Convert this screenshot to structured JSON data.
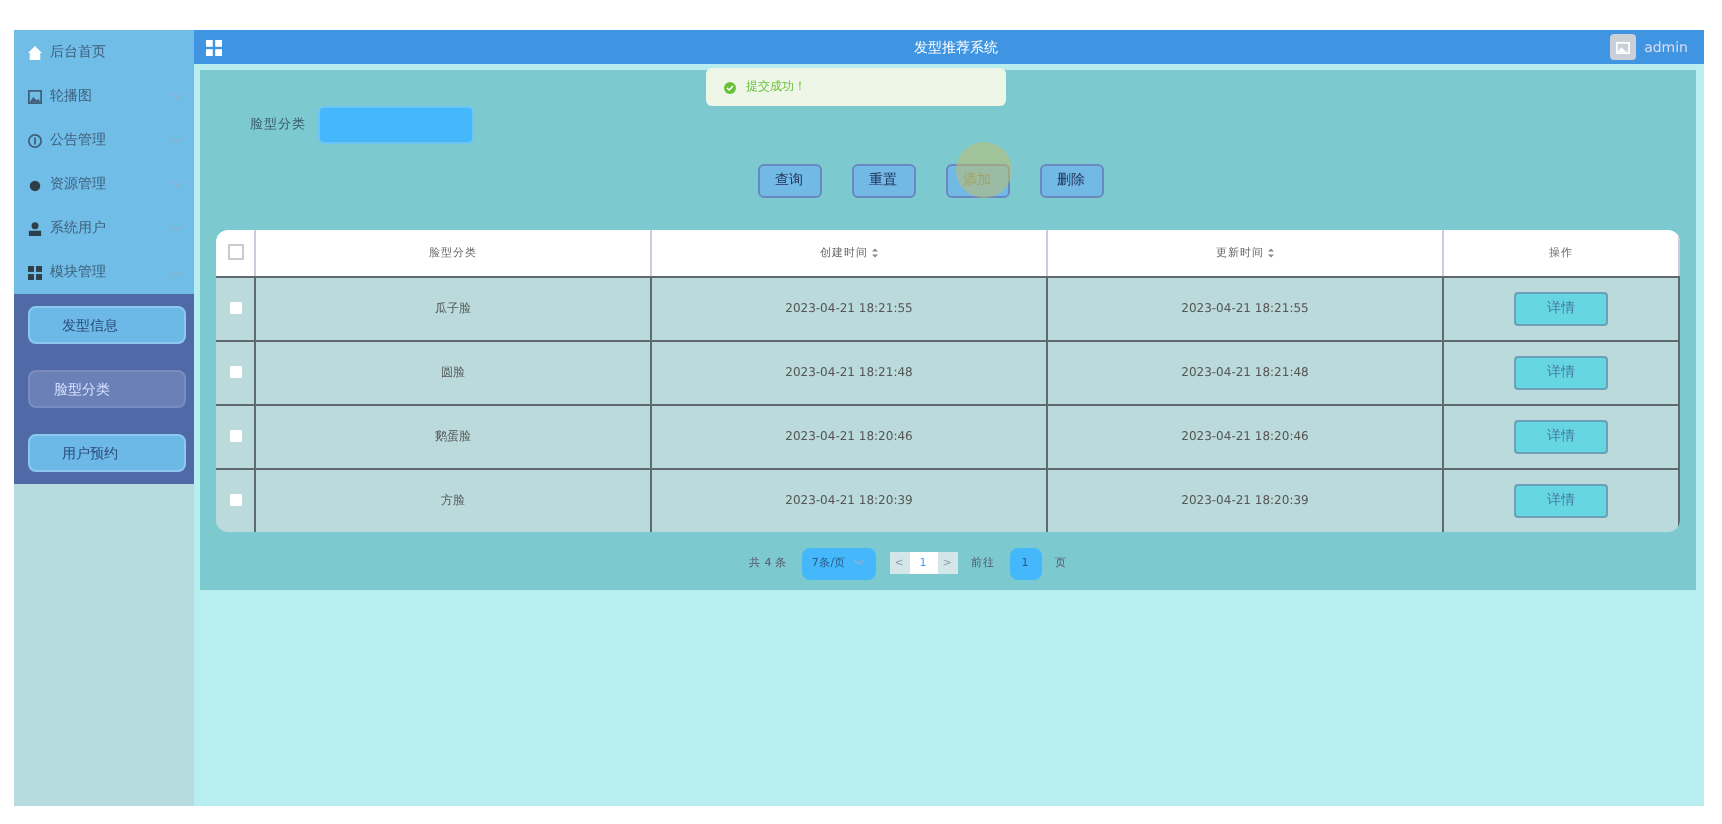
{
  "header": {
    "title": "发型推荐系统",
    "user": "admin"
  },
  "toast": {
    "text": "提交成功！"
  },
  "sidebar": {
    "items": [
      {
        "label": "后台首页",
        "kind": "link"
      },
      {
        "label": "轮播图",
        "kind": "menu",
        "expanded": false
      },
      {
        "label": "公告管理",
        "kind": "menu",
        "expanded": false
      },
      {
        "label": "资源管理",
        "kind": "menu",
        "expanded": false
      },
      {
        "label": "系统用户",
        "kind": "menu",
        "expanded": false
      },
      {
        "label": "模块管理",
        "kind": "menu",
        "expanded": true,
        "children": [
          {
            "label": "发型信息",
            "selected": false
          },
          {
            "label": "脸型分类",
            "selected": true
          },
          {
            "label": "用户预约",
            "selected": false
          }
        ]
      }
    ]
  },
  "search": {
    "label": "脸型分类"
  },
  "buttons": [
    {
      "label": "查询",
      "hovered": false
    },
    {
      "label": "重置",
      "hovered": false
    },
    {
      "label": "添加",
      "hovered": true
    },
    {
      "label": "删除",
      "hovered": false
    }
  ],
  "table": {
    "all_checked": false,
    "columns": [
      {
        "label": "脸型分类",
        "sortable": false
      },
      {
        "label": "创建时间",
        "sortable": true
      },
      {
        "label": "更新时间",
        "sortable": true
      },
      {
        "label": "操作",
        "sortable": false
      }
    ],
    "rows": [
      {
        "checked": false,
        "cells": [
          "瓜子脸",
          "2023-04-21 18:21:55",
          "2023-04-21 18:21:55"
        ],
        "action": "详情"
      },
      {
        "checked": false,
        "cells": [
          "圆脸",
          "2023-04-21 18:21:48",
          "2023-04-21 18:21:48"
        ],
        "action": "详情"
      },
      {
        "checked": false,
        "cells": [
          "鹅蛋脸",
          "2023-04-21 18:20:46",
          "2023-04-21 18:20:46"
        ],
        "action": "详情"
      },
      {
        "checked": false,
        "cells": [
          "方脸",
          "2023-04-21 18:20:39",
          "2023-04-21 18:20:39"
        ],
        "action": "详情"
      }
    ]
  },
  "pagination": {
    "total": "共 4 条",
    "page_size": "7条/页",
    "prev": "<",
    "current": "1",
    "next": ">",
    "goto_label": "前往",
    "goto_value": "1",
    "page_suffix": "页"
  }
}
